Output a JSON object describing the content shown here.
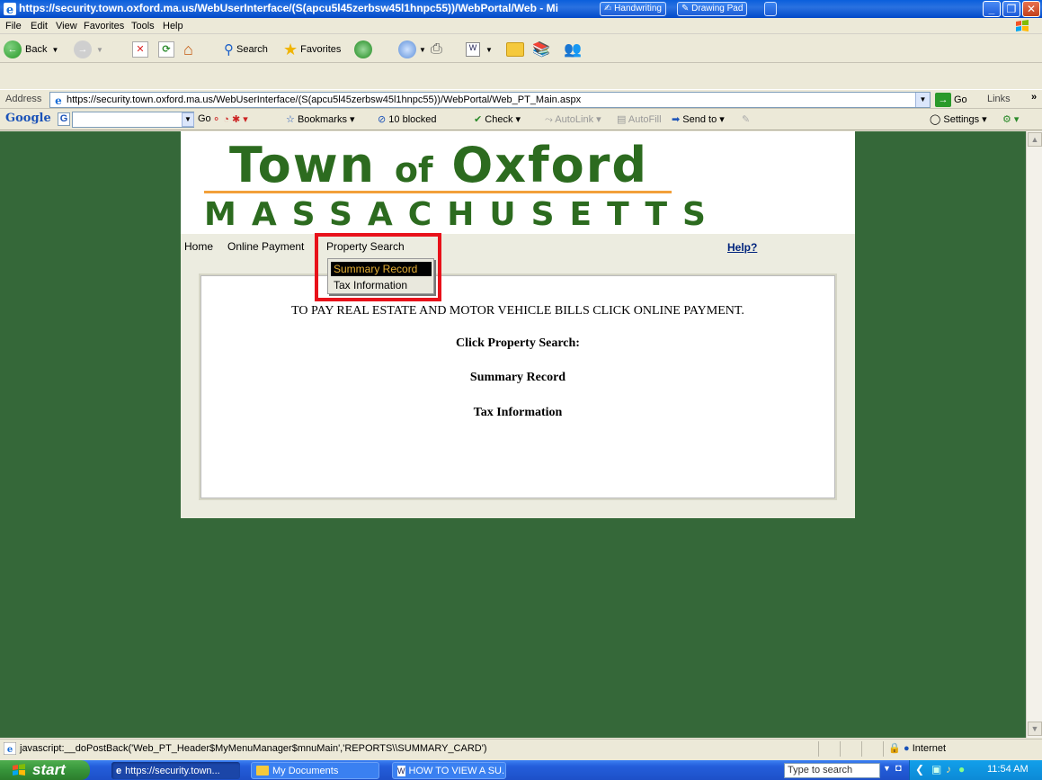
{
  "window": {
    "title": "https://security.town.oxford.ma.us/WebUserInterface/(S(apcu5l45zerbsw45l1hnpc55))/WebPortal/Web - Mi",
    "tablet_buttons": [
      "Handwriting",
      "Drawing Pad"
    ]
  },
  "menubar": {
    "items": [
      "File",
      "Edit",
      "View",
      "Favorites",
      "Tools",
      "Help"
    ]
  },
  "toolbar": {
    "back_label": "Back",
    "search_label": "Search",
    "favorites_label": "Favorites"
  },
  "addressbar": {
    "label": "Address",
    "url": "https://security.town.oxford.ma.us/WebUserInterface/(S(apcu5l45zerbsw45l1hnpc55))/WebPortal/Web_PT_Main.aspx",
    "go_label": "Go",
    "links_label": "Links"
  },
  "google_toolbar": {
    "logo": "Google",
    "go_label": "Go",
    "bookmarks_label": "Bookmarks",
    "blocked_label": "10 blocked",
    "check_label": "Check",
    "autolink_label": "AutoLink",
    "autofill_label": "AutoFill",
    "sendto_label": "Send to",
    "settings_label": "Settings"
  },
  "site": {
    "logo_town": "Town",
    "logo_of": "of",
    "logo_oxford": "Oxford",
    "logo_state": "MASSACHUSETTS",
    "nav": [
      "Home",
      "Online Payment",
      "Property Search"
    ],
    "help_label": "Help?",
    "dropdown": {
      "items": [
        "Summary Record",
        "Tax Information"
      ],
      "active_index": 0
    },
    "panel_lines": [
      "TO PAY REAL ESTATE AND MOTOR VEHICLE BILLS CLICK ONLINE PAYMENT.",
      "Click Property Search:",
      "Summary Record",
      "Tax Information"
    ],
    "colors": {
      "background": "#356839",
      "logo_green": "#2c6b1f",
      "logo_rule": "#f2a03a",
      "highlight": "#e8111a"
    }
  },
  "statusbar": {
    "text": "javascript:__doPostBack('Web_PT_Header$MyMenuManager$mnuMain','REPORTS\\\\SUMMARY_CARD')",
    "zone": "Internet"
  },
  "taskbar": {
    "start_label": "start",
    "tasks": [
      "https://security.town...",
      "My Documents",
      "HOW TO VIEW A SU..."
    ],
    "search_placeholder": "Type to search",
    "clock": "11:54 AM"
  }
}
